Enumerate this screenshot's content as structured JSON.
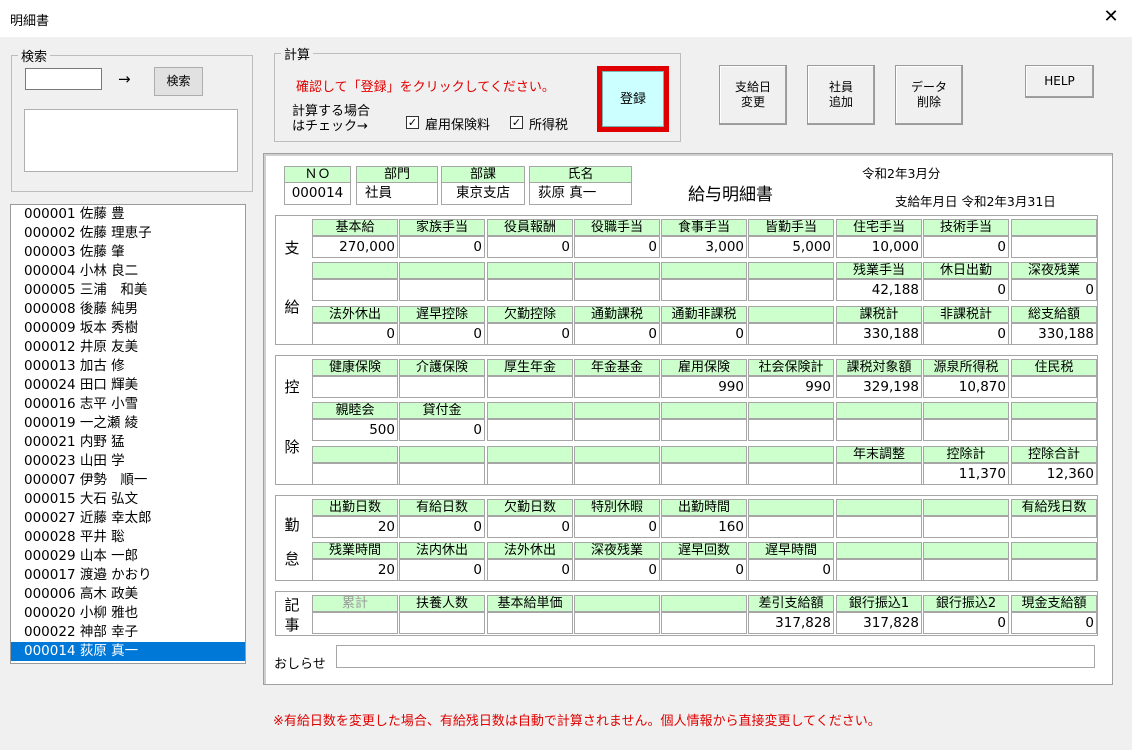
{
  "window": {
    "title": "明細書",
    "close_glyph": "✕"
  },
  "search": {
    "legend": "検索",
    "input_value": "",
    "arrow": "→",
    "button_label": "検索",
    "result_text": ""
  },
  "calc": {
    "legend": "計算",
    "instruction": "確認して「登録」をクリックしてください。",
    "label_line1": "計算する場合",
    "label_line2": "はチェック→",
    "check_employment": {
      "label": "雇用保険料",
      "checked": true
    },
    "check_income_tax": {
      "label": "所得税",
      "checked": true
    },
    "register_label": "登録"
  },
  "toolbar": {
    "payday_change": "支給日\n変更",
    "add_employee": "社員\n追加",
    "delete_data": "データ\n削除",
    "help": "HELP"
  },
  "employees": [
    "000001 佐藤 豊",
    "000002 佐藤 理恵子",
    "000003 佐藤 肇",
    "000004 小林 良二",
    "000005 三浦　和美",
    "000008 後藤 純男",
    "000009 坂本 秀樹",
    "000012 井原 友美",
    "000013 加古 修",
    "000024 田口 輝美",
    "000016 志平 小雪",
    "000019 一之瀬 綾",
    "000021 内野 猛",
    "000023 山田 学",
    "000007 伊勢　順一",
    "000015 大石 弘文",
    "000027 近藤 幸太郎",
    "000028 平井 聡",
    "000029 山本 一郎",
    "000017 渡邉 かおり",
    "000006 高木 政美",
    "000020 小柳 雅也",
    "000022 神部 幸子",
    "000014 荻原 真一"
  ],
  "selected_index": 23,
  "slip": {
    "info_headers": [
      "ＮＯ",
      "部門",
      "部課",
      "氏名"
    ],
    "info_values": [
      "000014",
      "社員",
      "東京支店",
      "荻原 真一"
    ],
    "title": "給与明細書",
    "period": "令和2年3月分",
    "pay_date": "支給年月日 令和2年3月31日",
    "section_labels": {
      "pay": [
        "支",
        "給"
      ],
      "deduction": [
        "控",
        "除"
      ],
      "attendance": [
        "勤",
        "怠"
      ],
      "notes": [
        "記",
        "事"
      ]
    },
    "pay_rows": [
      {
        "headers": [
          "基本給",
          "家族手当",
          "役員報酬",
          "役職手当",
          "食事手当",
          "皆勤手当",
          "住宅手当",
          "技術手当",
          ""
        ],
        "values": [
          "270,000",
          "0",
          "0",
          "0",
          "3,000",
          "5,000",
          "10,000",
          "0",
          ""
        ]
      },
      {
        "headers": [
          "",
          "",
          "",
          "",
          "",
          "",
          "残業手当",
          "休日出勤",
          "深夜残業"
        ],
        "values": [
          "",
          "",
          "",
          "",
          "",
          "",
          "42,188",
          "0",
          "0"
        ]
      },
      {
        "headers": [
          "法外休出",
          "遅早控除",
          "欠勤控除",
          "通勤課税",
          "通勤非課税",
          "",
          "課税計",
          "非課税計",
          "総支給額"
        ],
        "values": [
          "0",
          "0",
          "0",
          "0",
          "0",
          "",
          "330,188",
          "0",
          "330,188"
        ]
      }
    ],
    "deduction_rows": [
      {
        "headers": [
          "健康保険",
          "介護保険",
          "厚生年金",
          "年金基金",
          "雇用保険",
          "社会保険計",
          "課税対象額",
          "源泉所得税",
          "住民税"
        ],
        "values": [
          "",
          "",
          "",
          "",
          "990",
          "990",
          "329,198",
          "10,870",
          ""
        ]
      },
      {
        "headers": [
          "親睦会",
          "貸付金",
          "",
          "",
          "",
          "",
          "",
          "",
          ""
        ],
        "values": [
          "500",
          "0",
          "",
          "",
          "",
          "",
          "",
          "",
          ""
        ]
      },
      {
        "headers": [
          "",
          "",
          "",
          "",
          "",
          "",
          "年末調整",
          "控除計",
          "控除合計"
        ],
        "values": [
          "",
          "",
          "",
          "",
          "",
          "",
          "",
          "11,370",
          "12,360"
        ]
      }
    ],
    "attendance_rows": [
      {
        "headers": [
          "出勤日数",
          "有給日数",
          "欠勤日数",
          "特別休暇",
          "出勤時間",
          "",
          "",
          "",
          "有給残日数"
        ],
        "values": [
          "20",
          "0",
          "0",
          "0",
          "160",
          "",
          "",
          "",
          ""
        ]
      },
      {
        "headers": [
          "残業時間",
          "法内休出",
          "法外休出",
          "深夜残業",
          "遅早回数",
          "遅早時間",
          "",
          "",
          ""
        ],
        "values": [
          "20",
          "0",
          "0",
          "0",
          "0",
          "0",
          "",
          "",
          ""
        ]
      }
    ],
    "notes_row": {
      "headers": [
        "累計",
        "扶養人数",
        "基本給単価",
        "",
        "",
        "差引支給額",
        "銀行振込1",
        "銀行振込2",
        "現金支給額"
      ],
      "values": [
        "",
        "",
        "",
        "",
        "",
        "317,828",
        "317,828",
        "0",
        "0"
      ]
    },
    "notice_label": "おしらせ",
    "notice_value": ""
  },
  "footer_note": "※有給日数を変更した場合、有給残日数は自動で計算されません。個人情報から直接変更してください。",
  "colors": {
    "accent_red": "#e00000",
    "header_green": "#ccffcc",
    "register_bg": "#ccffff",
    "selection_blue": "#0078d7"
  }
}
